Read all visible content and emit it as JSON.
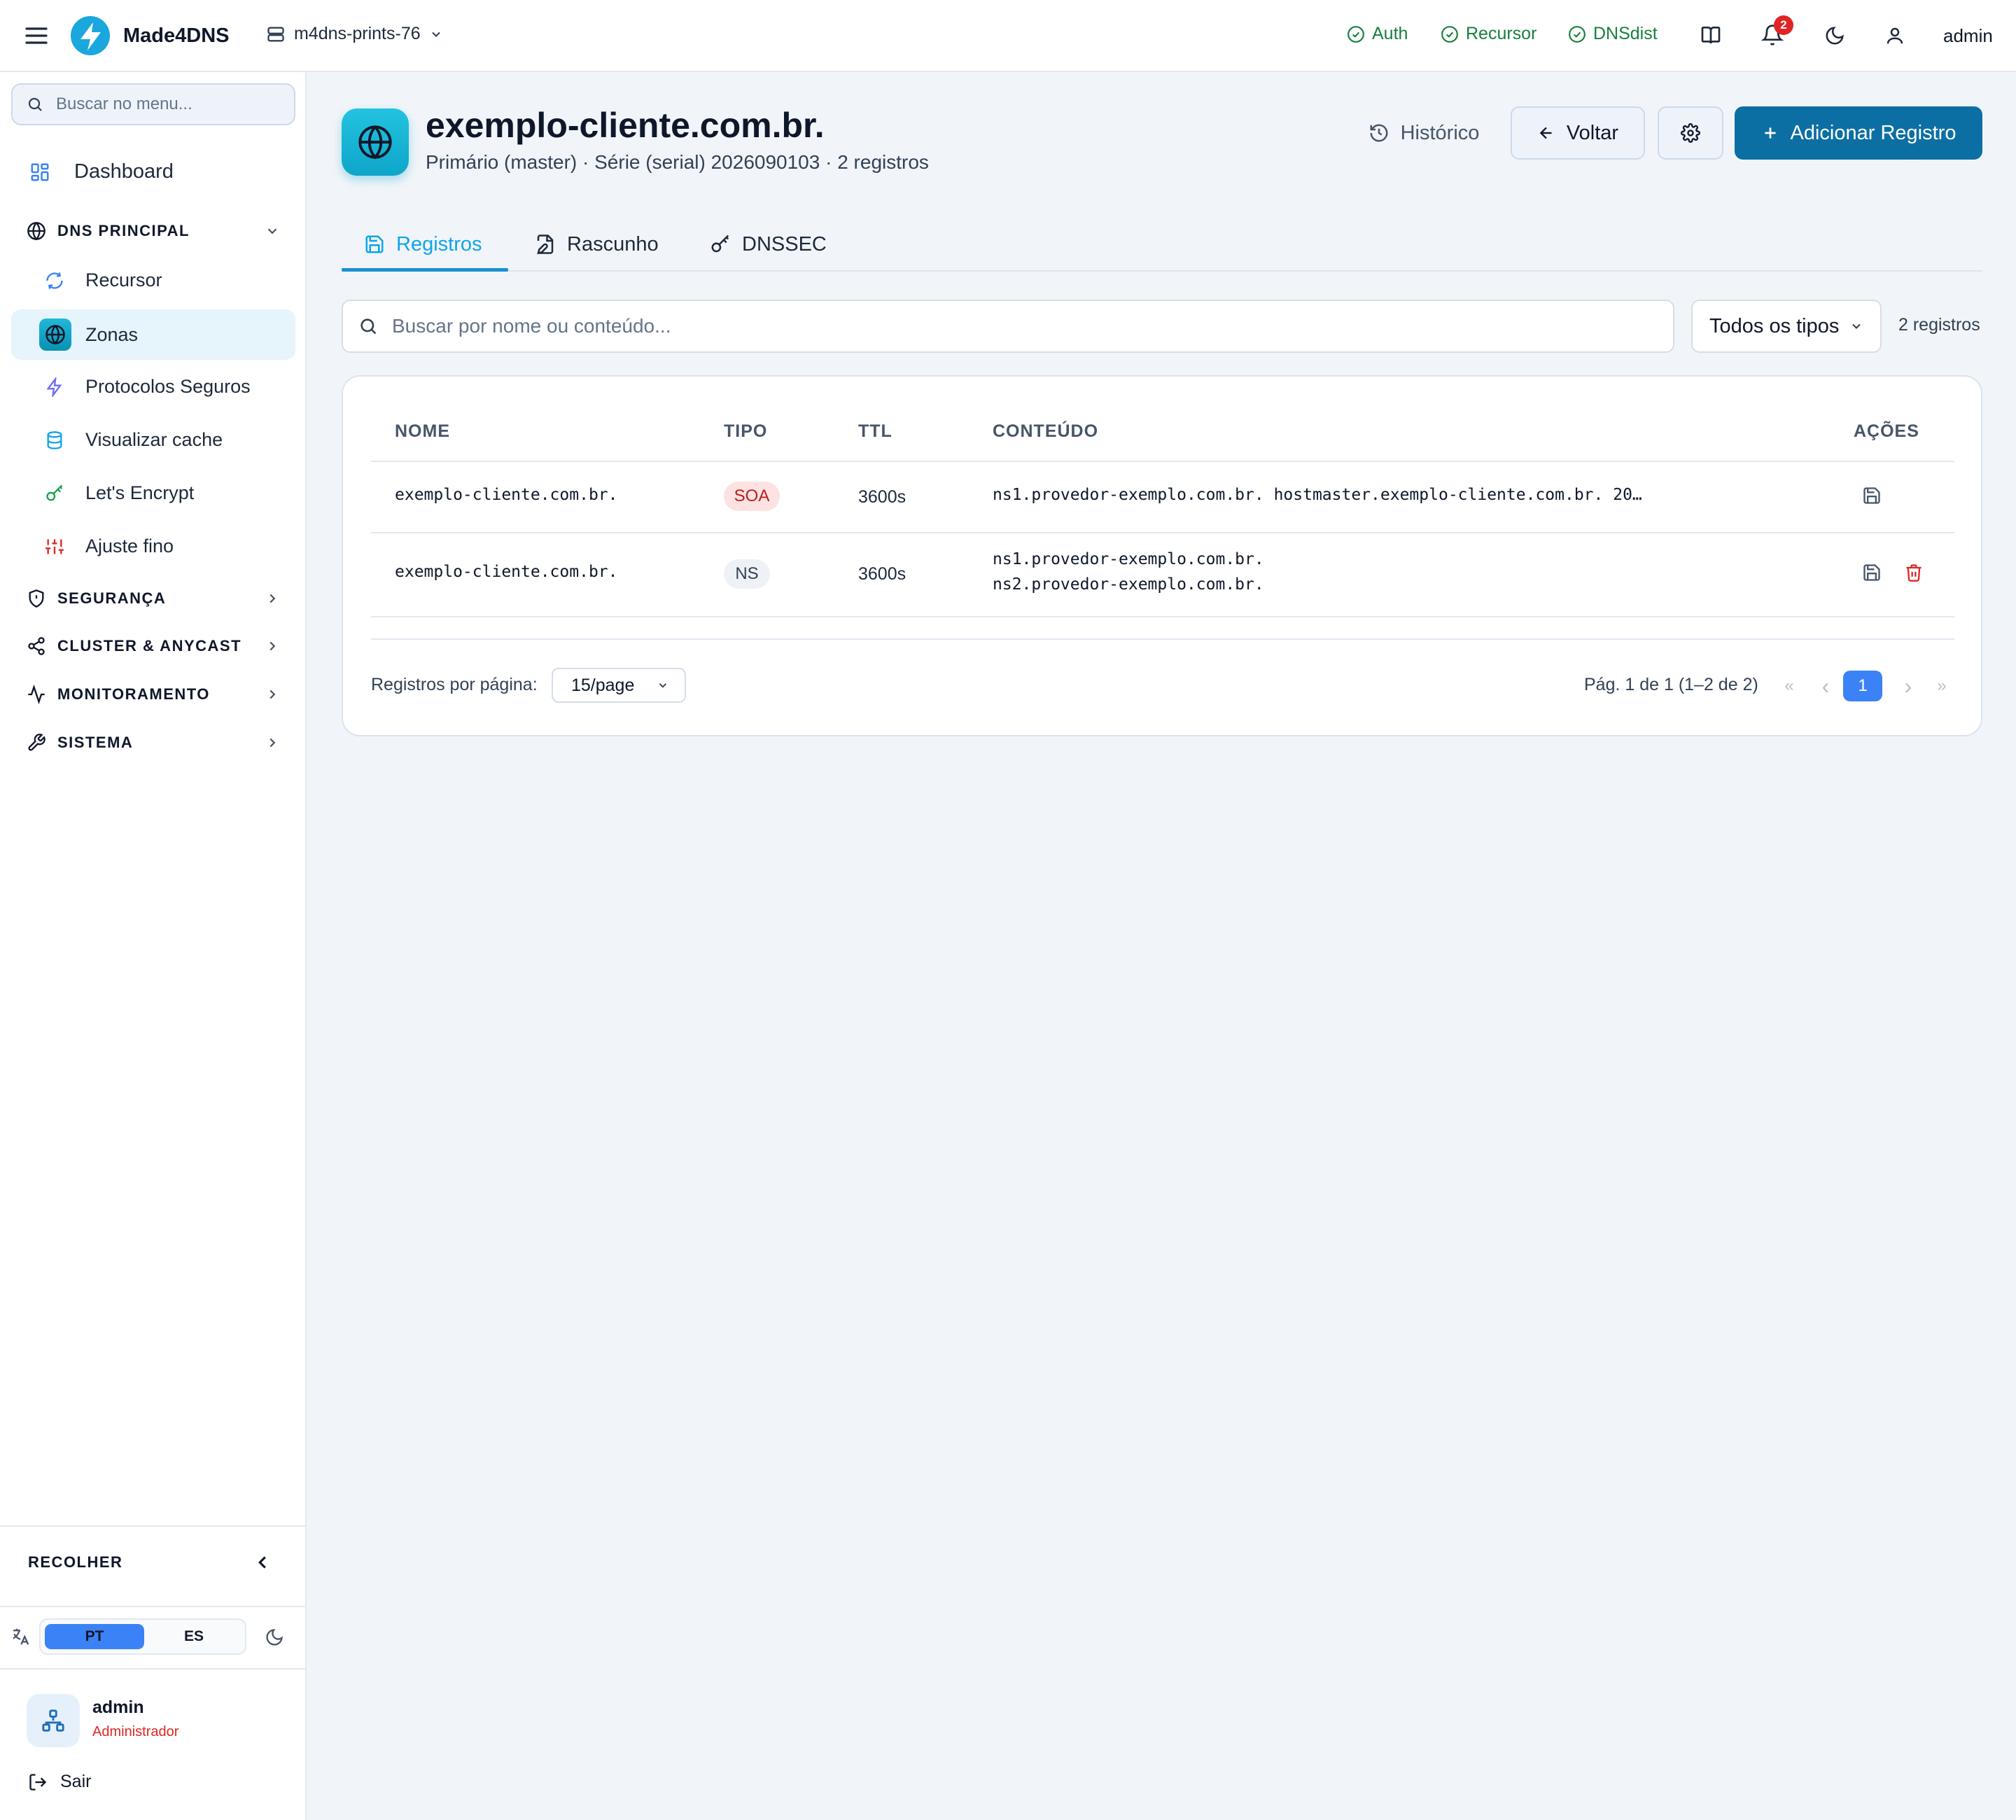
{
  "topbar": {
    "brand": "Made4DNS",
    "server": "m4dns-prints-76",
    "statuses": [
      "Auth",
      "Recursor",
      "DNSdist"
    ],
    "notification_count": "2",
    "user": "admin"
  },
  "sidebar": {
    "search_placeholder": "Buscar no menu...",
    "dashboard": "Dashboard",
    "dns_section": "DNS PRINCIPAL",
    "dns_items": [
      "Recursor",
      "Zonas",
      "Protocolos Seguros",
      "Visualizar cache",
      "Let's Encrypt",
      "Ajuste fino"
    ],
    "sections": [
      "SEGURANÇA",
      "CLUSTER & ANYCAST",
      "MONITORAMENTO",
      "SISTEMA"
    ],
    "collapse": "RECOLHER",
    "languages": [
      "PT",
      "ES"
    ],
    "user_name": "admin",
    "user_role": "Administrador",
    "logout": "Sair"
  },
  "zone": {
    "title": "exemplo-cliente.com.br.",
    "subtitle": "Primário (master) · Série (serial) 2026090103 · 2 registros"
  },
  "actions": {
    "history": "Histórico",
    "back": "Voltar",
    "add": "Adicionar Registro"
  },
  "tabs": [
    "Registros",
    "Rascunho",
    "DNSSEC"
  ],
  "filters": {
    "search_placeholder": "Buscar por nome ou conteúdo...",
    "type": "Todos os tipos",
    "count": "2 registros"
  },
  "table": {
    "headers": [
      "NOME",
      "TIPO",
      "TTL",
      "CONTEÚDO",
      "AÇÕES"
    ],
    "rows": [
      {
        "name": "exemplo-cliente.com.br.",
        "type": "SOA",
        "ttl": "3600s",
        "content": [
          "ns1.provedor-exemplo.com.br. hostmaster.exemplo-cliente.com.br. 20…"
        ]
      },
      {
        "name": "exemplo-cliente.com.br.",
        "type": "NS",
        "ttl": "3600s",
        "content": [
          "ns1.provedor-exemplo.com.br.",
          "ns2.provedor-exemplo.com.br."
        ]
      }
    ]
  },
  "pagination": {
    "per_page_label": "Registros por página:",
    "per_page": "15/page",
    "info": "Pág. 1 de 1 (1–2 de 2)",
    "first": "«",
    "prev": "‹",
    "current": "1",
    "next": "›",
    "last": "»"
  },
  "colors": {
    "primary": "#0c6fa3",
    "accent": "#0ea5e9",
    "status_ok": "#16803c",
    "danger": "#dc2626"
  }
}
